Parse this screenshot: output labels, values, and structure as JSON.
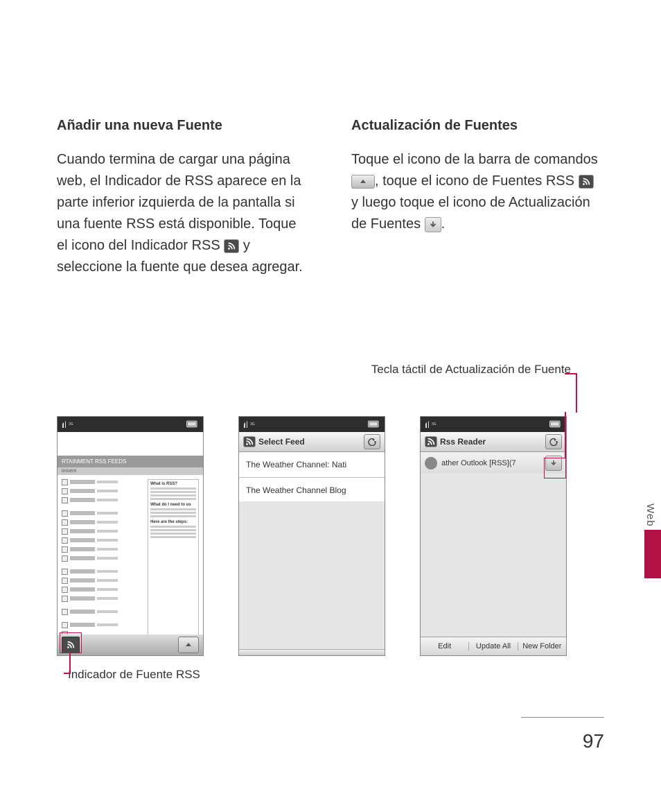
{
  "left": {
    "heading": "Añadir una nueva Fuente",
    "p1a": "Cuando termina de cargar una página web, el Indicador de RSS aparece en la parte inferior izquierda de la pantalla si una fuente RSS está disponible. Toque el icono del Indicador RSS ",
    "p1b": " y seleccione la fuente que desea agregar."
  },
  "right": {
    "heading": "Actualización de Fuentes",
    "p1a": "Toque el icono de la barra de comandos ",
    "p1b": ", toque el icono de Fuentes RSS ",
    "p1c": " y luego toque el icono de Actualización de Fuentes ",
    "p1d": "."
  },
  "callouts": {
    "update_key": "Tecla táctil de Actualización de Fuente",
    "rss_indicator": "Indicador de Fuente RSS"
  },
  "shot1": {
    "section_title": "RTAINMENT RSS FEEDS",
    "section_sub": "inment",
    "box_h1": "What is RSS?",
    "box_h2": "What do I need to us",
    "box_h3": "Here are the steps:"
  },
  "shot2": {
    "title": "Select Feed",
    "row1": "The Weather Channel: Nati",
    "row2": "The Weather Channel Blog"
  },
  "shot3": {
    "title": "Rss Reader",
    "row1": "ather Outlook [RSS](7",
    "btn1": "Edit",
    "btn2": "Update All",
    "btn3": "New Folder"
  },
  "side_tab": "Web",
  "page_no": "97"
}
